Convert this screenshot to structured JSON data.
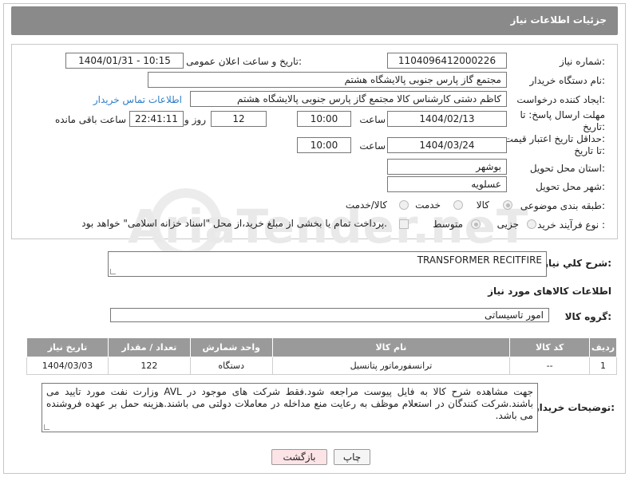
{
  "header": {
    "title": "جزئیات اطلاعات نیاز"
  },
  "fields": {
    "need_number_label": "شماره نیاز:",
    "need_number": "1104096412000226",
    "announce_label": "تاریخ و ساعت اعلان عمومی:",
    "announce_value": "1404/01/31 - 10:15",
    "buyer_org_label": "نام دستگاه خریدار:",
    "buyer_org": "مجتمع گاز پارس جنوبی  پالایشگاه هشتم",
    "requester_label": "ایجاد کننده درخواست:",
    "requester": "کاظم دشتی کارشناس کالا مجتمع گاز پارس جنوبی  پالایشگاه هشتم",
    "contact_link": "اطلاعات تماس خریدار",
    "deadline_label_1": "مهلت ارسال پاسخ: تا",
    "deadline_label_2": "تاریخ:",
    "deadline_date": "1404/02/13",
    "time_label": "ساعت",
    "deadline_time": "10:00",
    "days": "12",
    "days_label": "روز و",
    "remaining_time": "22:41:11",
    "remaining_label": "ساعت باقی مانده",
    "price_label_1": "حداقل تاریخ اعتبار قیمت:",
    "price_label_2": "تا تاریخ:",
    "price_date": "1404/03/24",
    "price_time": "10:00",
    "province_label": "استان محل تحویل:",
    "province": "بوشهر",
    "city_label": "شهر محل تحویل:",
    "city": "عسلویه",
    "category_label": "طبقه بندی موضوعی:",
    "category_options": [
      "کالا",
      "خدمت",
      "کالا/خدمت"
    ],
    "process_label": "نوع فرآیند خرید :",
    "process_options": [
      "جزیی",
      "متوسط"
    ],
    "payment_note": "پرداخت تمام یا بخشی از مبلغ خرید،از محل \"اسناد خزانه اسلامی\" خواهد بود."
  },
  "summary": {
    "label": "شرح کلي نياز:",
    "value": "TRANSFORMER RECITFIRE"
  },
  "items_section": {
    "title": "اطلاعات کالاهای مورد نیاز",
    "group_label": "گروه کالا:",
    "group_value": "امور تاسیساتی",
    "columns": [
      "ردیف",
      "کد کالا",
      "نام کالا",
      "واحد شمارش",
      "تعداد / مقدار",
      "تاریخ نیاز"
    ],
    "rows": [
      [
        "1",
        "--",
        "ترانسفورماتور پتانسیل",
        "دستگاه",
        "122",
        "1404/03/03"
      ]
    ]
  },
  "notes": {
    "label": "توضیحات خریدار:",
    "value": "جهت مشاهده شرح کالا به فایل پیوست مراجعه شود.فقط شرکت های موجود در AVL وزارت نفت مورد تایید می باشند.شرکت کنندگان در استعلام موظف به رعایت منع مداخله در معاملات دولتی می باشند.هزینه حمل بر عهده فروشنده می باشد."
  },
  "buttons": {
    "print": "چاپ",
    "back": "بازگشت"
  },
  "watermark": "AriaTender.neT",
  "colors": {
    "header_bg": "#8a8a8a",
    "link": "#2e7fc8",
    "back_button": "#fbe3e6",
    "table_header": "#9a9a9a"
  }
}
